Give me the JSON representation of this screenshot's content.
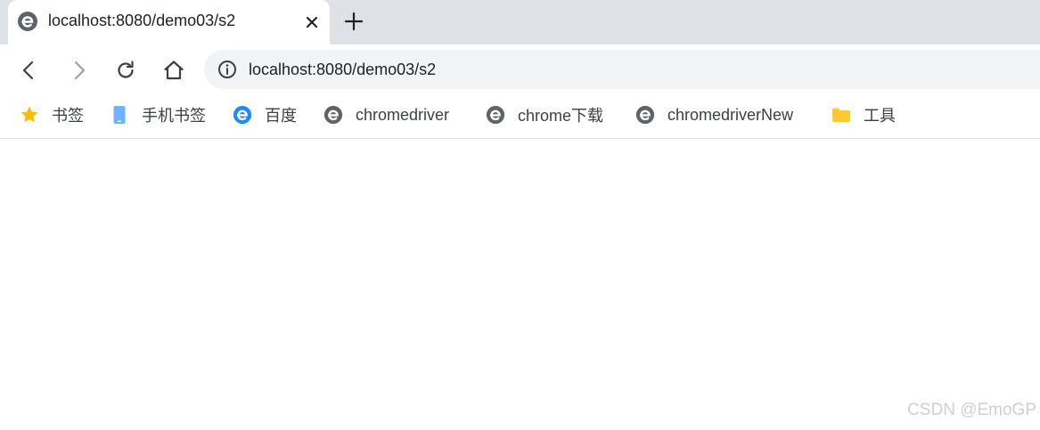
{
  "tab": {
    "title": "localhost:8080/demo03/s2",
    "favicon": "browser-e-icon",
    "close": "close-icon"
  },
  "new_tab": "plus-icon",
  "toolbar": {
    "back": "back-arrow-icon",
    "forward": "forward-arrow-icon",
    "reload": "reload-icon",
    "home": "home-icon",
    "url": "localhost:8080/demo03/s2",
    "site_info": "info-icon"
  },
  "bookmarks": [
    {
      "label": "书签",
      "icon": "star-icon",
      "color": "#fbbc04"
    },
    {
      "label": "手机书签",
      "icon": "phone-icon",
      "color": "#6fb2ff"
    },
    {
      "label": "百度",
      "icon": "browser-e-icon-blue",
      "color": "#1a8cff"
    },
    {
      "label": "chromedriver",
      "icon": "browser-e-icon",
      "color": "#5f6368"
    },
    {
      "label": "chrome下载",
      "icon": "browser-e-icon",
      "color": "#5f6368"
    },
    {
      "label": "chromedriverNew",
      "icon": "browser-e-icon",
      "color": "#5f6368"
    },
    {
      "label": "工具",
      "icon": "folder-icon",
      "color": "#fcc934"
    }
  ],
  "watermark": "CSDN @EmoGP"
}
